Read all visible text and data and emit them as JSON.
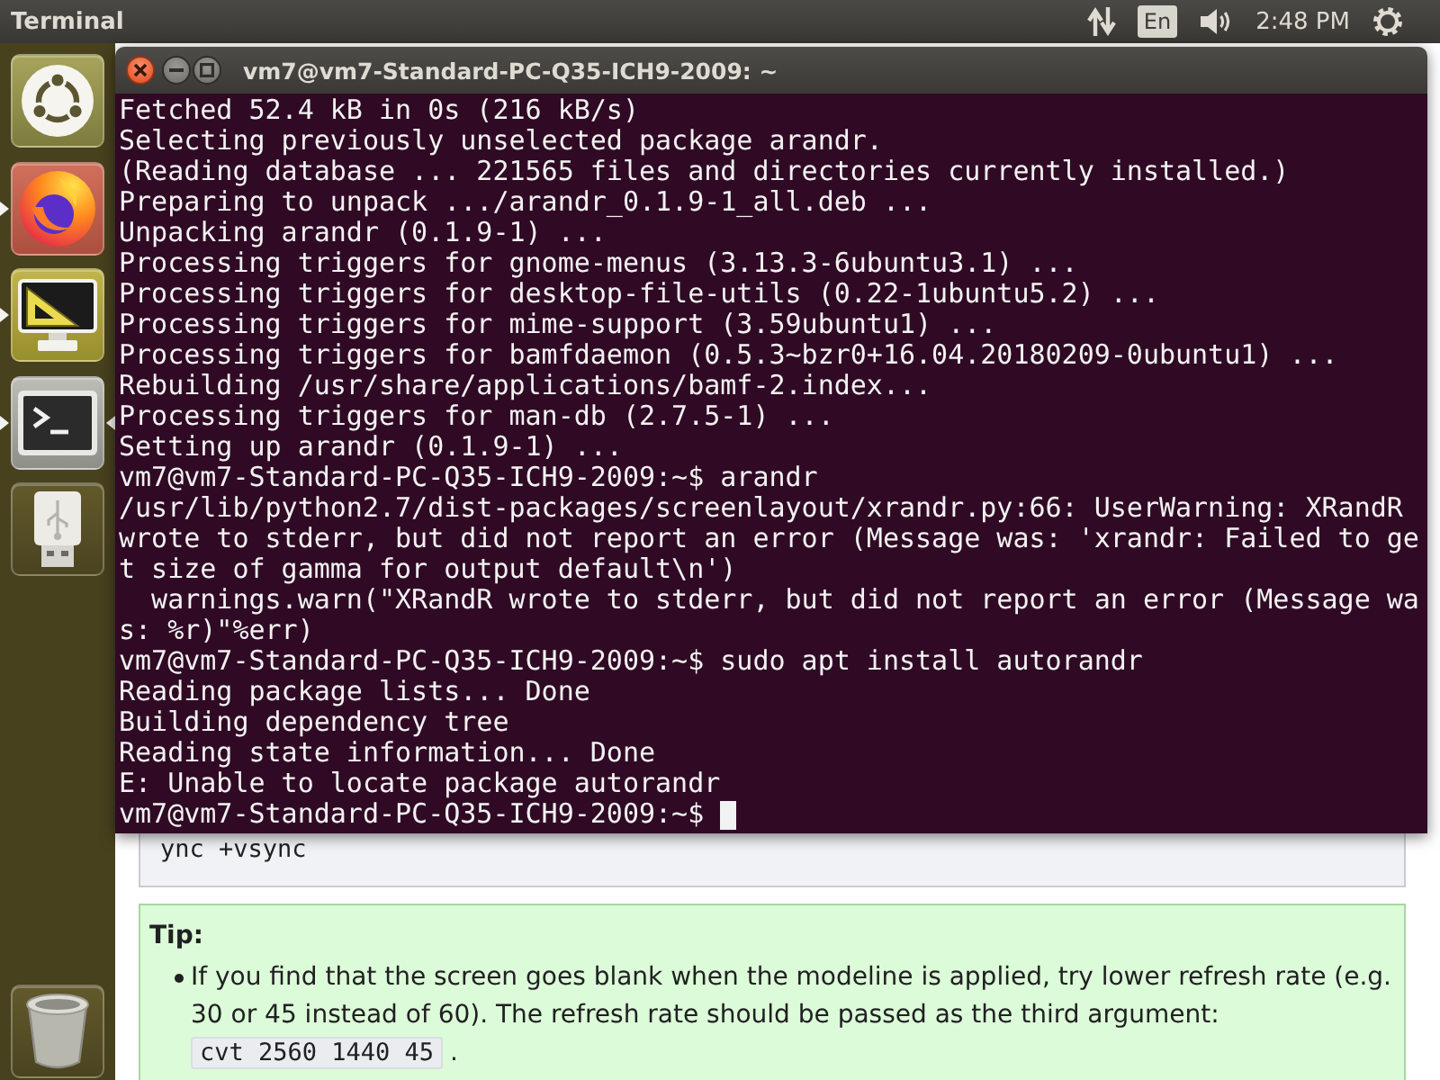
{
  "top_panel": {
    "app_title": "Terminal",
    "keyboard_layout": "En",
    "clock": "2:48 PM"
  },
  "launcher": {
    "items": [
      {
        "kind": "dash",
        "running": false,
        "focused": false
      },
      {
        "kind": "browser",
        "running": true,
        "focused": false
      },
      {
        "kind": "display",
        "running": true,
        "focused": false
      },
      {
        "kind": "terminal",
        "running": true,
        "focused": true
      },
      {
        "kind": "usb-drive",
        "running": false,
        "focused": false
      },
      {
        "kind": "trash",
        "running": false,
        "focused": false
      }
    ]
  },
  "terminal_window": {
    "title": "vm7@vm7-Standard-PC-Q35-ICH9-2009: ~",
    "lines": [
      "Fetched 52.4 kB in 0s (216 kB/s)",
      "Selecting previously unselected package arandr.",
      "(Reading database ... 221565 files and directories currently installed.)",
      "Preparing to unpack .../arandr_0.1.9-1_all.deb ...",
      "Unpacking arandr (0.1.9-1) ...",
      "Processing triggers for gnome-menus (3.13.3-6ubuntu3.1) ...",
      "Processing triggers for desktop-file-utils (0.22-1ubuntu5.2) ...",
      "Processing triggers for mime-support (3.59ubuntu1) ...",
      "Processing triggers for bamfdaemon (0.5.3~bzr0+16.04.20180209-0ubuntu1) ...",
      "Rebuilding /usr/share/applications/bamf-2.index...",
      "Processing triggers for man-db (2.7.5-1) ...",
      "Setting up arandr (0.1.9-1) ...",
      "vm7@vm7-Standard-PC-Q35-ICH9-2009:~$ arandr",
      "/usr/lib/python2.7/dist-packages/screenlayout/xrandr.py:66: UserWarning: XRandR",
      "wrote to stderr, but did not report an error (Message was: 'xrandr: Failed to ge",
      "t size of gamma for output default\\n')",
      "  warnings.warn(\"XRandR wrote to stderr, but did not report an error (Message wa",
      "s: %r)\"%err)",
      "vm7@vm7-Standard-PC-Q35-ICH9-2009:~$ sudo apt install autorandr",
      "Reading package lists... Done",
      "Building dependency tree",
      "Reading state information... Done",
      "E: Unable to locate package autorandr",
      "vm7@vm7-Standard-PC-Q35-ICH9-2009:~$"
    ],
    "cursor": true
  },
  "web_page": {
    "code_block": {
      "text": "ync +vsync"
    },
    "tip": {
      "heading": "Tip:",
      "items": [
        {
          "text": "If you find that the screen goes blank when the modeline is applied, try lower refresh rate (e.g. 30 or 45 instead of 60). The refresh rate should be passed as the third argument:",
          "code": "cvt 2560 1440 45",
          "after": "."
        }
      ]
    }
  }
}
